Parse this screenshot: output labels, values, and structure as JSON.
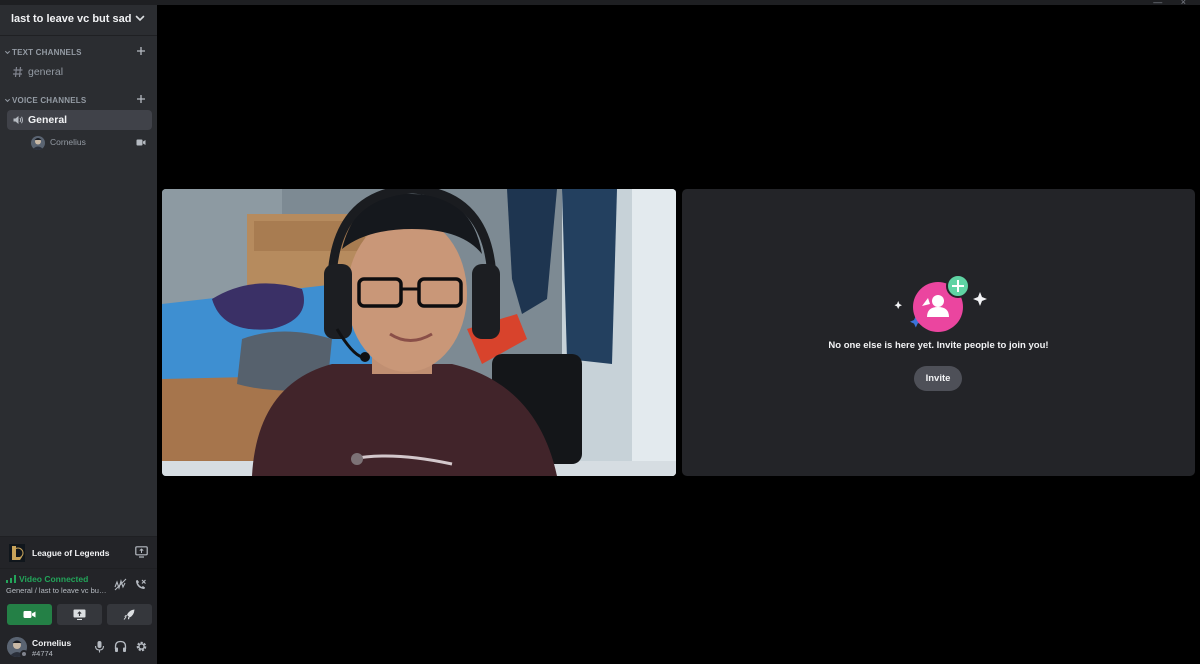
{
  "window": {
    "controls": "— ×"
  },
  "server": {
    "name": "last to leave vc but sad"
  },
  "categories": {
    "text": {
      "label": "TEXT CHANNELS"
    },
    "voice": {
      "label": "VOICE CHANNELS"
    }
  },
  "channels": {
    "text": [
      {
        "name": "general"
      }
    ],
    "voice": [
      {
        "name": "General",
        "active": true
      }
    ]
  },
  "voice_members": [
    {
      "name": "Cornelius",
      "video": true
    }
  ],
  "activity": {
    "game": "League of Legends"
  },
  "voice_status": {
    "status": "Video Connected",
    "location": "General / last to leave vc but sad",
    "status_color": "#23a55a"
  },
  "user": {
    "name": "Cornelius",
    "tag": "#4774"
  },
  "empty_tile": {
    "message": "No one else is here yet. Invite people to join you!",
    "invite_label": "Invite"
  },
  "colors": {
    "sidebar": "#2b2d31",
    "panel": "#232428",
    "accent_green": "#248046",
    "invite_pink": "#eb459f",
    "invite_plus": "#5fd3a3"
  }
}
